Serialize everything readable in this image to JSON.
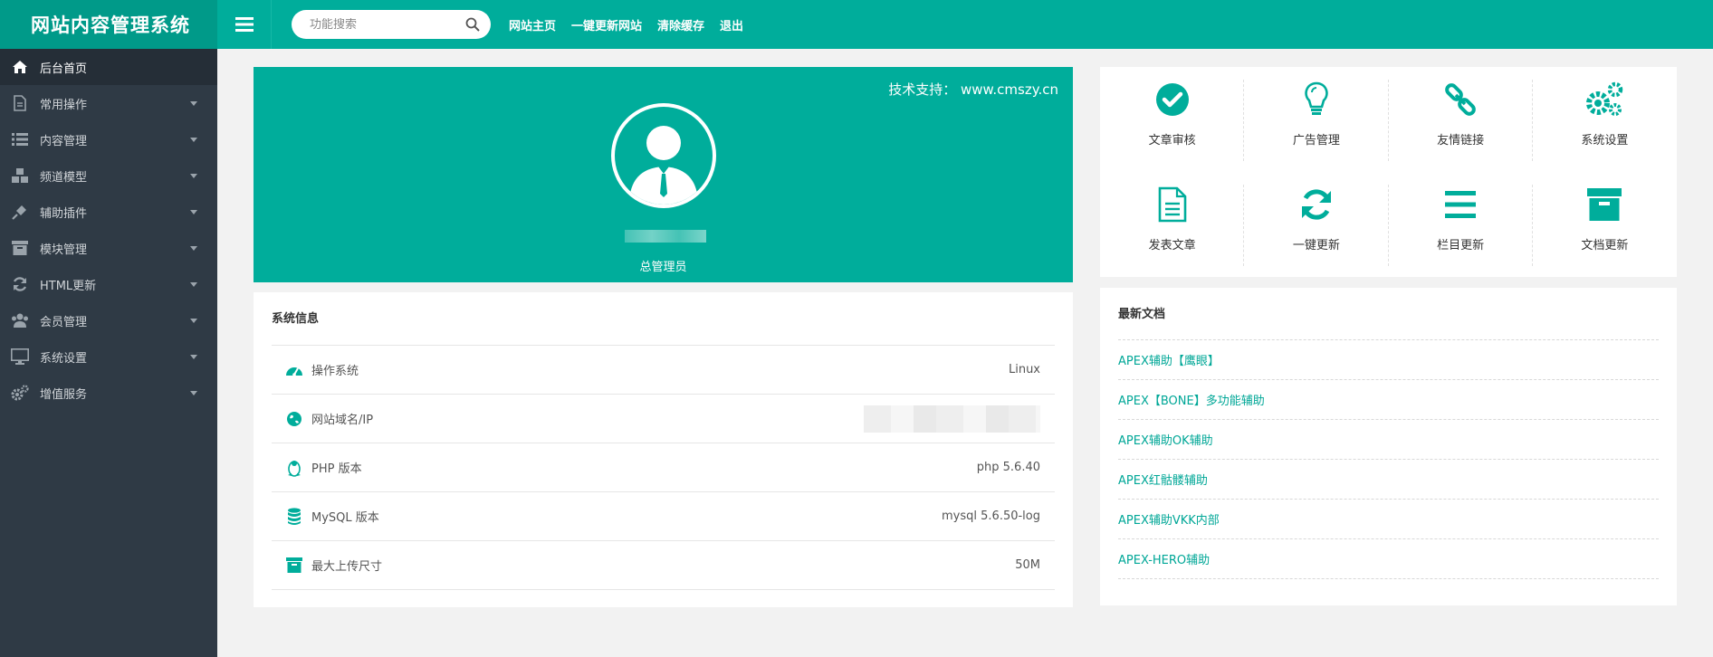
{
  "app": {
    "title": "网站内容管理系统",
    "accent": "#00ad9b",
    "sidebar_bg": "#2f3a45"
  },
  "topbar": {
    "search_placeholder": "功能搜索",
    "links": [
      "网站主页",
      "一键更新网站",
      "清除缓存",
      "退出"
    ]
  },
  "sidebar": {
    "items": [
      {
        "label": "后台首页",
        "icon": "home-icon",
        "active": true
      },
      {
        "label": "常用操作",
        "icon": "document-icon"
      },
      {
        "label": "内容管理",
        "icon": "list-icon"
      },
      {
        "label": "频道模型",
        "icon": "cubes-icon"
      },
      {
        "label": "辅助插件",
        "icon": "plug-icon"
      },
      {
        "label": "模块管理",
        "icon": "archive-icon"
      },
      {
        "label": "HTML更新",
        "icon": "refresh-icon"
      },
      {
        "label": "会员管理",
        "icon": "users-icon"
      },
      {
        "label": "系统设置",
        "icon": "monitor-icon"
      },
      {
        "label": "增值服务",
        "icon": "cogs-icon"
      }
    ]
  },
  "profile": {
    "support_text": "技术支持： www.cmszy.cn",
    "role": "总管理员"
  },
  "sysinfo": {
    "title": "系统信息",
    "rows": [
      {
        "label": "操作系统",
        "value": "Linux",
        "icon": "dashboard-icon"
      },
      {
        "label": "网站域名/IP",
        "value": "",
        "icon": "globe-icon"
      },
      {
        "label": "PHP 版本",
        "value": "php 5.6.40",
        "icon": "linux-icon"
      },
      {
        "label": "MySQL 版本",
        "value": "mysql 5.6.50-log",
        "icon": "database-icon"
      },
      {
        "label": "最大上传尺寸",
        "value": "50M",
        "icon": "archive-icon"
      }
    ]
  },
  "quick": {
    "items": [
      {
        "label": "文章审核",
        "icon": "check-circle-icon"
      },
      {
        "label": "广告管理",
        "icon": "lightbulb-icon"
      },
      {
        "label": "友情链接",
        "icon": "link-icon"
      },
      {
        "label": "系统设置",
        "icon": "cogs-icon"
      },
      {
        "label": "发表文章",
        "icon": "file-text-icon"
      },
      {
        "label": "一键更新",
        "icon": "refresh-icon"
      },
      {
        "label": "栏目更新",
        "icon": "bars-icon"
      },
      {
        "label": "文档更新",
        "icon": "archive-icon"
      }
    ]
  },
  "latest": {
    "title": "最新文档",
    "docs": [
      "APEX辅助【鹰眼】",
      "APEX【BONE】多功能辅助",
      "APEX辅助OK辅助",
      "APEX红骷髅辅助",
      "APEX辅助VKK内部",
      "APEX-HERO辅助"
    ]
  }
}
